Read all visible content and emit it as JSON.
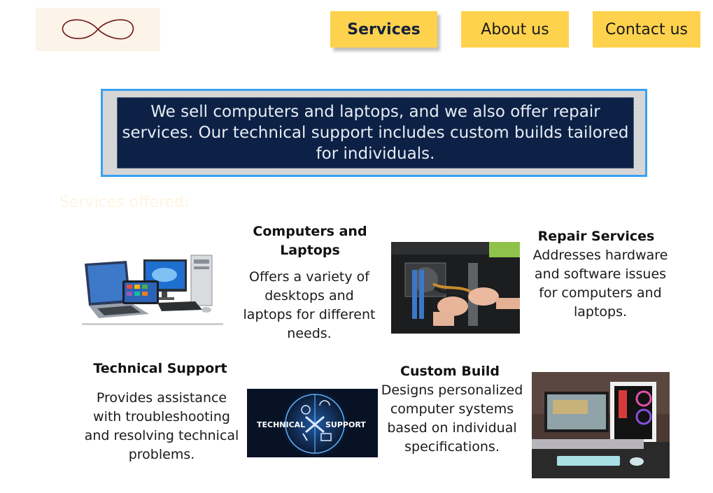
{
  "nav": {
    "services": "Services",
    "about": "About us",
    "contact": "Contact us"
  },
  "intro": {
    "text": "We sell computers and laptops, and we also offer repair services. Our technical support includes custom builds tailored for individuals."
  },
  "section": {
    "title": "Services offered:"
  },
  "services": {
    "computers": {
      "title": "Computers and Laptops",
      "description": "Offers a variety of desktops and laptops for different needs."
    },
    "repair": {
      "title": "Repair Services",
      "description": "Addresses hardware and software issues for computers and laptops."
    },
    "support": {
      "title": "Technical Support",
      "description": "Provides assistance with troubleshooting and resolving technical problems.",
      "image_text_left": "TECHNICAL",
      "image_text_right": "SUPPORT"
    },
    "custom": {
      "title": "Custom Build",
      "description": "Designs personalized computer systems based on individual specifications."
    }
  },
  "colors": {
    "nav_bg": "#ffd24d",
    "intro_bg": "#0c2145",
    "intro_border": "#3aa0f0",
    "logo_bg": "#fdf4e9"
  }
}
